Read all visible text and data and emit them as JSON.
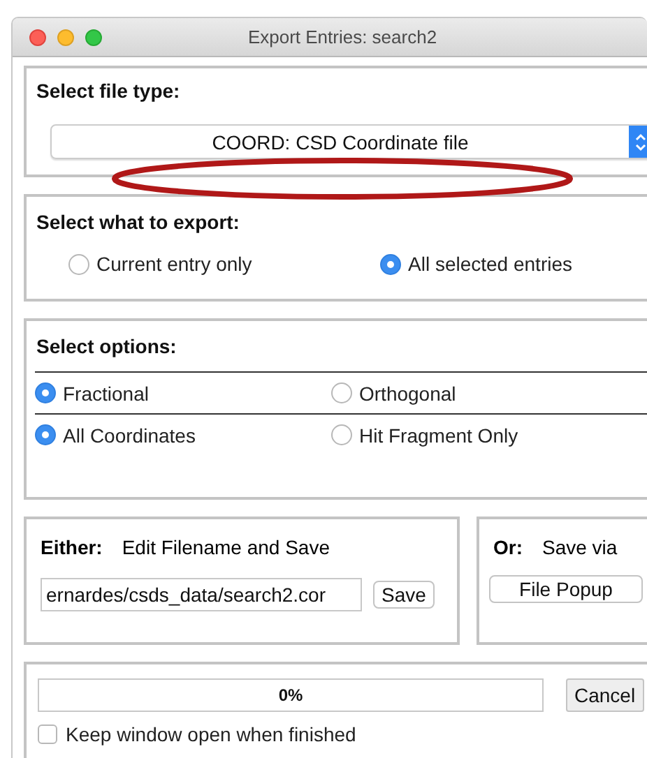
{
  "window": {
    "title": "Export Entries: search2"
  },
  "file_type": {
    "heading": "Select file type:",
    "value": "COORD: CSD Coordinate file"
  },
  "annotation": {
    "kind": "ellipse"
  },
  "export": {
    "heading": "Select what to export:",
    "options": [
      {
        "label": "Current entry only",
        "selected": false
      },
      {
        "label": "All selected entries",
        "selected": true
      }
    ]
  },
  "options": {
    "heading": "Select options:",
    "rows": [
      {
        "choices": [
          {
            "label": "Fractional",
            "selected": true
          },
          {
            "label": "Orthogonal",
            "selected": false
          }
        ]
      },
      {
        "choices": [
          {
            "label": "All Coordinates",
            "selected": true
          },
          {
            "label": "Hit Fragment Only",
            "selected": false
          }
        ]
      }
    ]
  },
  "either": {
    "heading": "Either:",
    "caption": "Edit Filename and Save",
    "filename": "ernardes/csds_data/search2.cor",
    "button": "Save"
  },
  "or": {
    "heading": "Or:",
    "caption": "Save via",
    "button": "File Popup"
  },
  "progress": {
    "level": 0,
    "reading": "0%",
    "button": "Cancel"
  },
  "keep_open": {
    "label": "Keep window open when finished",
    "checked": false
  }
}
